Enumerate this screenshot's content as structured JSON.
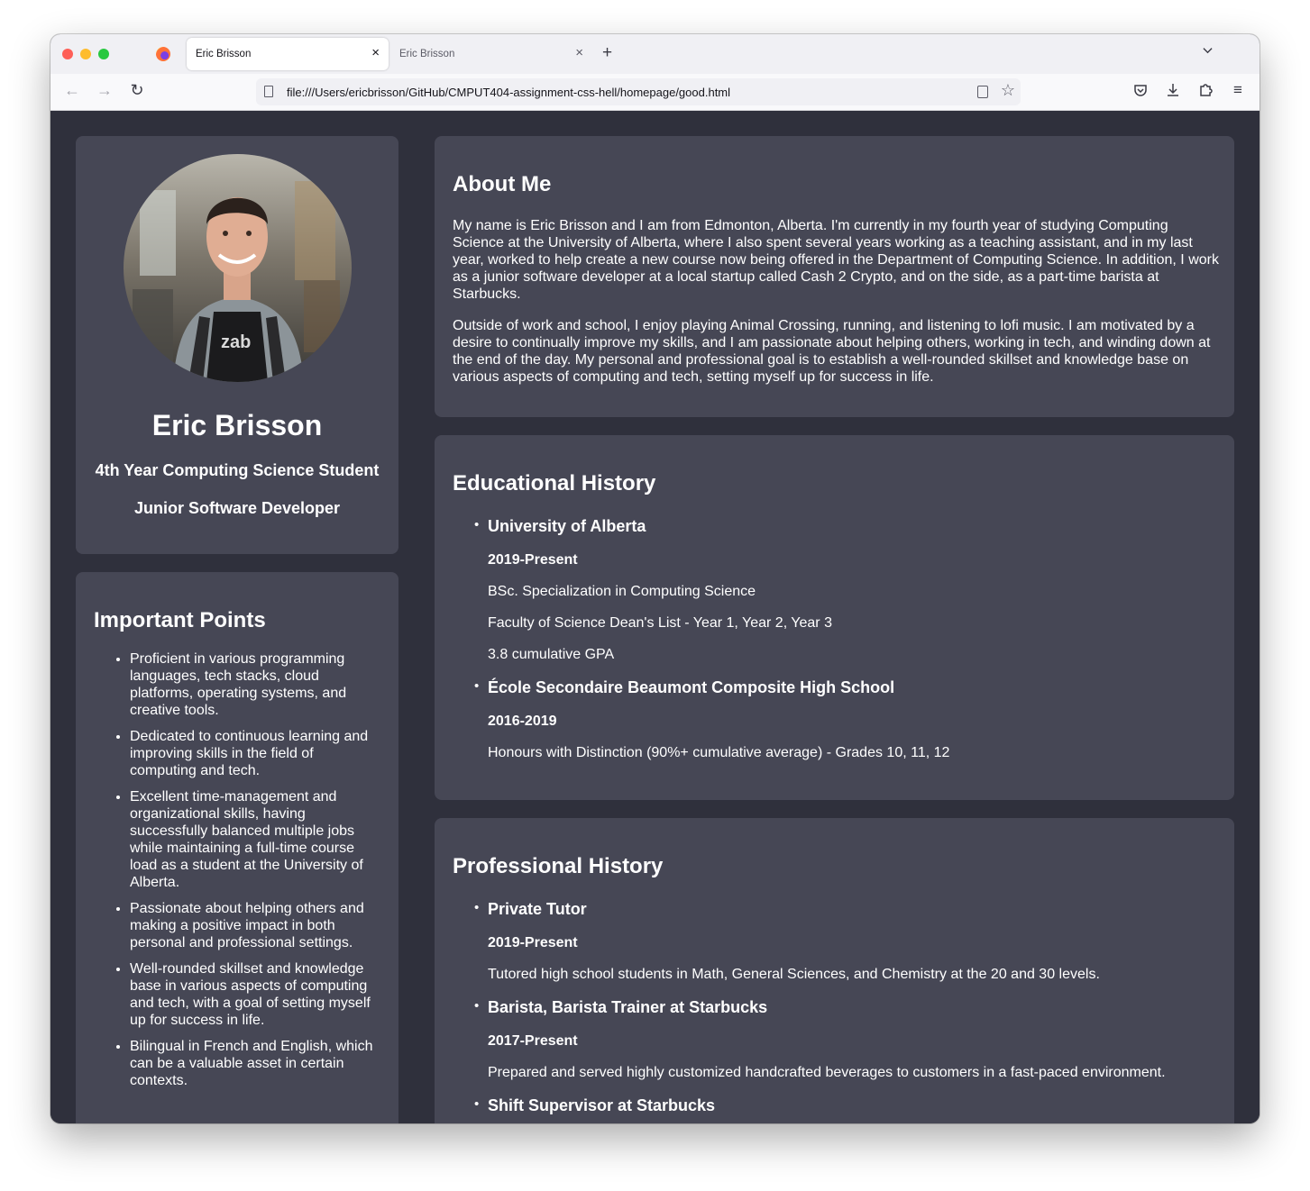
{
  "browser": {
    "tabs": [
      {
        "title": "Eric Brisson",
        "active": true
      },
      {
        "title": "Eric Brisson",
        "active": false
      }
    ],
    "url": "file:///Users/ericbrisson/GitHub/CMPUT404-assignment-css-hell/homepage/good.html",
    "icons": {
      "close": "×",
      "new_tab": "+",
      "back": "←",
      "forward": "→",
      "reload": "↻",
      "star": "☆",
      "menu": "≡"
    }
  },
  "profile": {
    "name": "Eric Brisson",
    "subtitle_1": "4th Year Computing Science Student",
    "subtitle_2": "Junior Software Developer"
  },
  "points": {
    "title": "Important Points",
    "items": [
      "Proficient in various programming languages, tech stacks, cloud platforms, operating systems, and creative tools.",
      "Dedicated to continuous learning and improving skills in the field of computing and tech.",
      "Excellent time-management and organizational skills, having successfully balanced multiple jobs while maintaining a full-time course load as a student at the University of Alberta.",
      "Passionate about helping others and making a positive impact in both personal and professional settings.",
      "Well-rounded skillset and knowledge base in various aspects of computing and tech, with a goal of setting myself up for success in life.",
      "Bilingual in French and English, which can be a valuable asset in certain contexts."
    ]
  },
  "about": {
    "title": "About Me",
    "p1": "My name is Eric Brisson and I am from Edmonton, Alberta. I'm currently in my fourth year of studying Computing Science at the University of Alberta, where I also spent several years working as a teaching assistant, and in my last year, worked to help create a new course now being offered in the Department of Computing Science. In addition, I work as a junior software developer at a local startup called Cash 2 Crypto, and on the side, as a part-time barista at Starbucks.",
    "p2": "Outside of work and school, I enjoy playing Animal Crossing, running, and listening to lofi music. I am motivated by a desire to continually improve my skills, and I am passionate about helping others, working in tech, and winding down at the end of the day. My personal and professional goal is to establish a well-rounded skillset and knowledge base on various aspects of computing and tech, setting myself up for success in life."
  },
  "education": {
    "title": "Educational History",
    "entries": [
      {
        "school": "University of Alberta",
        "years": "2019-Present",
        "details": [
          "BSc. Specialization in Computing Science",
          "Faculty of Science Dean's List - Year 1, Year 2, Year 3",
          "3.8 cumulative GPA"
        ]
      },
      {
        "school": "École Secondaire Beaumont Composite High School",
        "years": "2016-2019",
        "details": [
          "Honours with Distinction (90%+ cumulative average) - Grades 10, 11, 12"
        ]
      }
    ]
  },
  "professional": {
    "title": "Professional History",
    "entries": [
      {
        "role": "Private Tutor",
        "years": "2019-Present",
        "description": "Tutored high school students in Math, General Sciences, and Chemistry at the 20 and 30 levels."
      },
      {
        "role": "Barista, Barista Trainer at Starbucks",
        "years": "2017-Present",
        "description": "Prepared and served highly customized handcrafted beverages to customers in a fast-paced environment."
      },
      {
        "role": "Shift Supervisor at Starbucks"
      }
    ]
  }
}
